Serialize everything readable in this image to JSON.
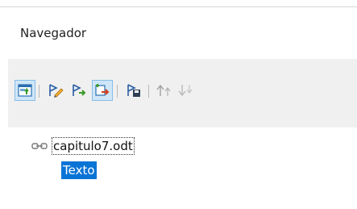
{
  "navigator": {
    "title": "Navegador",
    "toolbar": [
      {
        "icon": "content-navigation-view-icon",
        "active": true
      },
      {
        "icon": "set-reminder-icon",
        "active": false
      },
      {
        "icon": "header-navigation-icon",
        "active": false
      },
      {
        "icon": "drag-mode-icon",
        "active": true
      },
      {
        "icon": "document-dropdown-icon",
        "active": false
      },
      {
        "icon": "promote-level-icon",
        "active": false,
        "disabled": true
      },
      {
        "icon": "demote-level-icon",
        "active": false,
        "disabled": true
      }
    ],
    "tree": {
      "document_label": "capitulo7.odt",
      "items": [
        {
          "label": "Texto",
          "selected": true
        }
      ]
    }
  },
  "colors": {
    "selection": "#0a74d6",
    "panel_bg": "#f0f0f0",
    "active_button_bg": "#cfe6f8"
  }
}
